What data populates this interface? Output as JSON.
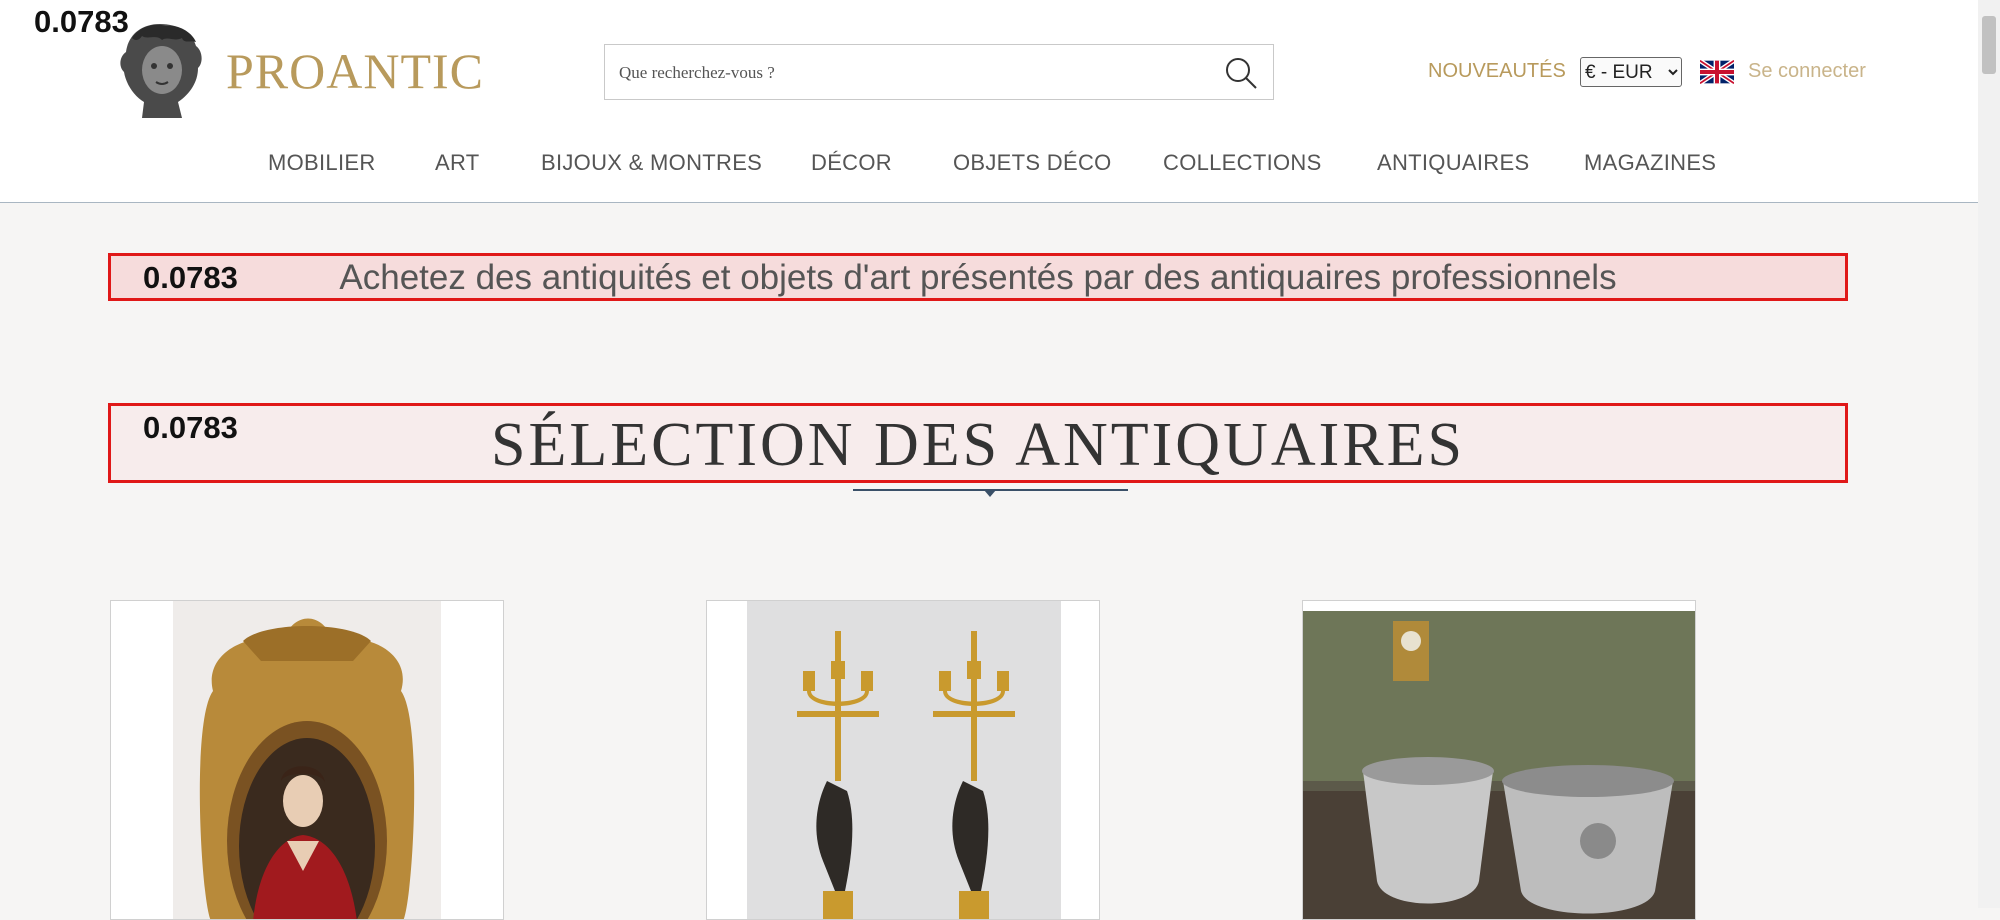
{
  "logo": {
    "text": "PROANTIC"
  },
  "search": {
    "placeholder": "Que recherchez-vous ?"
  },
  "header": {
    "nouveautes": "NOUVEAUTÉS",
    "currency": "€ - EUR",
    "login": "Se connecter"
  },
  "nav": [
    "MOBILIER",
    "ART",
    "BIJOUX & MONTRES",
    "DÉCOR",
    "OBJETS DÉCO",
    "COLLECTIONS",
    "ANTIQUAIRES",
    "MAGAZINES"
  ],
  "scores": {
    "corner": "0.0783",
    "banner": "0.0783",
    "section": "0.0783"
  },
  "banner": {
    "text": "Achetez des antiquités et objets d'art présentés par des antiquaires professionnels"
  },
  "section": {
    "title": "SÉLECTION DES ANTIQUAIRES"
  },
  "icons": {
    "search": "search-icon",
    "flag": "uk-flag-icon",
    "logo": "bust-logo-icon"
  },
  "colors": {
    "brand_gold": "#b89a5c",
    "highlight_border": "#e01818",
    "nav_text": "#555555"
  }
}
